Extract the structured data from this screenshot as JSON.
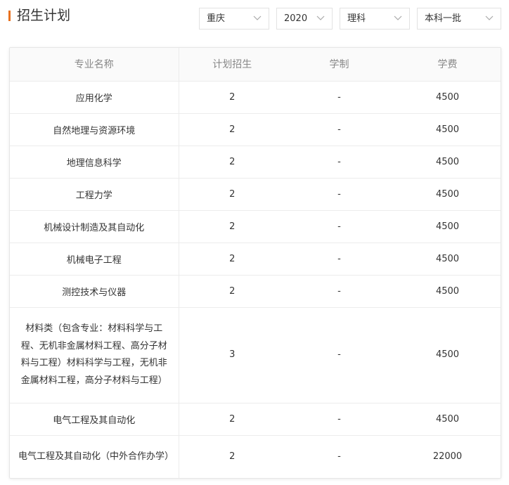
{
  "header": {
    "title": "招生计划",
    "filters": {
      "province": "重庆",
      "year": "2020",
      "subject": "理科",
      "batch": "本科一批"
    }
  },
  "table": {
    "columns": [
      "专业名称",
      "计划招生",
      "学制",
      "学费"
    ],
    "rows": [
      {
        "name": "应用化学",
        "plan": "2",
        "duration": "-",
        "fee": "4500"
      },
      {
        "name": "自然地理与资源环境",
        "plan": "2",
        "duration": "-",
        "fee": "4500"
      },
      {
        "name": "地理信息科学",
        "plan": "2",
        "duration": "-",
        "fee": "4500"
      },
      {
        "name": "工程力学",
        "plan": "2",
        "duration": "-",
        "fee": "4500"
      },
      {
        "name": "机械设计制造及其自动化",
        "plan": "2",
        "duration": "-",
        "fee": "4500"
      },
      {
        "name": "机械电子工程",
        "plan": "2",
        "duration": "-",
        "fee": "4500"
      },
      {
        "name": "测控技术与仪器",
        "plan": "2",
        "duration": "-",
        "fee": "4500"
      },
      {
        "name": "材料类（包含专业：材料科学与工程、无机非金属材料工程、高分子材料与工程）材料科学与工程，无机非金属材料工程，高分子材料与工程）",
        "plan": "3",
        "duration": "-",
        "fee": "4500"
      },
      {
        "name": "电气工程及其自动化",
        "plan": "2",
        "duration": "-",
        "fee": "4500"
      },
      {
        "name": "电气工程及其自动化（中外合作办学）",
        "plan": "2",
        "duration": "-",
        "fee": "22000"
      }
    ]
  },
  "colors": {
    "accent": "#e8711f",
    "border": "#e6e6e6",
    "header_text": "#888888"
  }
}
